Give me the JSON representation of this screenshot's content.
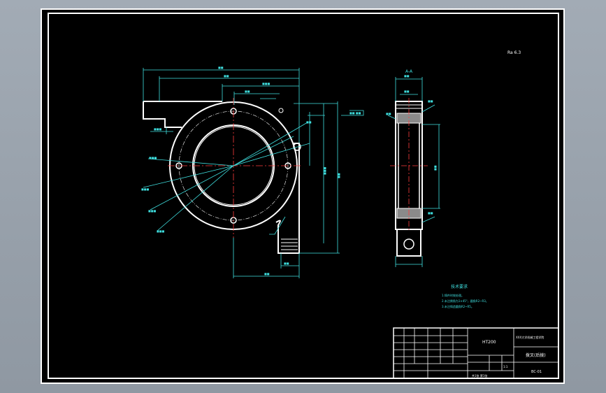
{
  "drawing": {
    "roughness_note": "Ra 6.3",
    "section_label": "A-A",
    "tech_req": {
      "title": "技术要求",
      "lines": [
        "1.铸件时效处理。",
        "2.未注倒角为1×45°，圆角R2~R3。",
        "3.未注铸造圆角R2~R5。"
      ]
    },
    "title_block": {
      "material": "HT200",
      "school": "XXX大学机械工程学院",
      "part_name": "拨叉(后拨)",
      "drawing_no": "BC-01",
      "scale": "1:1",
      "sheet": "共1张 第1张"
    }
  }
}
